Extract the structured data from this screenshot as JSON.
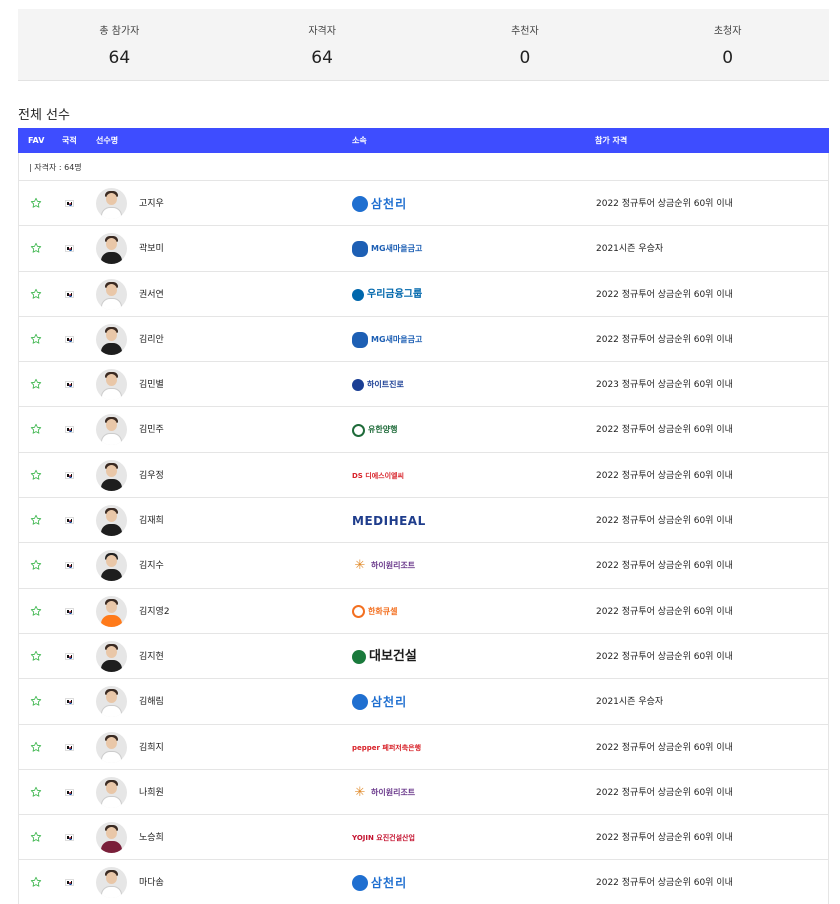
{
  "stats": [
    {
      "label": "총 참가자",
      "value": "64"
    },
    {
      "label": "자격자",
      "value": "64"
    },
    {
      "label": "추천자",
      "value": "0"
    },
    {
      "label": "초청자",
      "value": "0"
    }
  ],
  "section_title": "전체 선수",
  "table": {
    "headers": {
      "fav": "FAV",
      "nation": "국적",
      "player": "선수명",
      "affiliation": "소속",
      "qualification": "참가 자격"
    },
    "group_label": "| 자격자 : 64명",
    "rows": [
      {
        "name": "고지우",
        "sponsor": "삼천리",
        "qualification": "2022 정규투어 상금순위 60위 이내"
      },
      {
        "name": "곽보미",
        "sponsor": "MG새마을금고",
        "qualification": "2021시즌 우승자"
      },
      {
        "name": "권서연",
        "sponsor": "우리금융그룹",
        "qualification": "2022 정규투어 상금순위 60위 이내"
      },
      {
        "name": "김리안",
        "sponsor": "MG새마을금고",
        "qualification": "2022 정규투어 상금순위 60위 이내"
      },
      {
        "name": "김민별",
        "sponsor": "하이트진로",
        "qualification": "2023 정규투어 상금순위 60위 이내"
      },
      {
        "name": "김민주",
        "sponsor": "유한양행",
        "qualification": "2022 정규투어 상금순위 60위 이내"
      },
      {
        "name": "김우정",
        "sponsor": "DS 디에스이엘씨",
        "qualification": "2022 정규투어 상금순위 60위 이내"
      },
      {
        "name": "김재희",
        "sponsor": "MEDIHEAL",
        "qualification": "2022 정규투어 상금순위 60위 이내"
      },
      {
        "name": "김지수",
        "sponsor": "하이원리조트",
        "qualification": "2022 정규투어 상금순위 60위 이내"
      },
      {
        "name": "김지영2",
        "sponsor": "한화큐셀",
        "qualification": "2022 정규투어 상금순위 60위 이내"
      },
      {
        "name": "김지현",
        "sponsor": "대보건설",
        "qualification": "2022 정규투어 상금순위 60위 이내"
      },
      {
        "name": "김해림",
        "sponsor": "삼천리",
        "qualification": "2021시즌 우승자"
      },
      {
        "name": "김희지",
        "sponsor": "pepper 페퍼저축은행",
        "qualification": "2022 정규투어 상금순위 60위 이내"
      },
      {
        "name": "나희원",
        "sponsor": "하이원리조트",
        "qualification": "2022 정규투어 상금순위 60위 이내"
      },
      {
        "name": "노승희",
        "sponsor": "YOJIN 요진건설산업",
        "qualification": "2022 정규투어 상금순위 60위 이내"
      },
      {
        "name": "마다솜",
        "sponsor": "삼천리",
        "qualification": "2022 정규투어 상금순위 60위 이내"
      }
    ]
  },
  "colors": {
    "header_blue": "#3e4dff",
    "star_green": "#39b54a",
    "samchully": "#1f6fd0",
    "mg": "#1d5fb4",
    "woori": "#0067ac",
    "hite": "#1b3f95",
    "yuhan": "#1f6b3a",
    "ds": "#d8232a",
    "mediheal": "#1f3d8c",
    "high1": "#6b3a8c",
    "hanwha": "#f37021",
    "daebo": "#1a7a3c",
    "pepper": "#d8232a",
    "yojin": "#c4122f"
  }
}
